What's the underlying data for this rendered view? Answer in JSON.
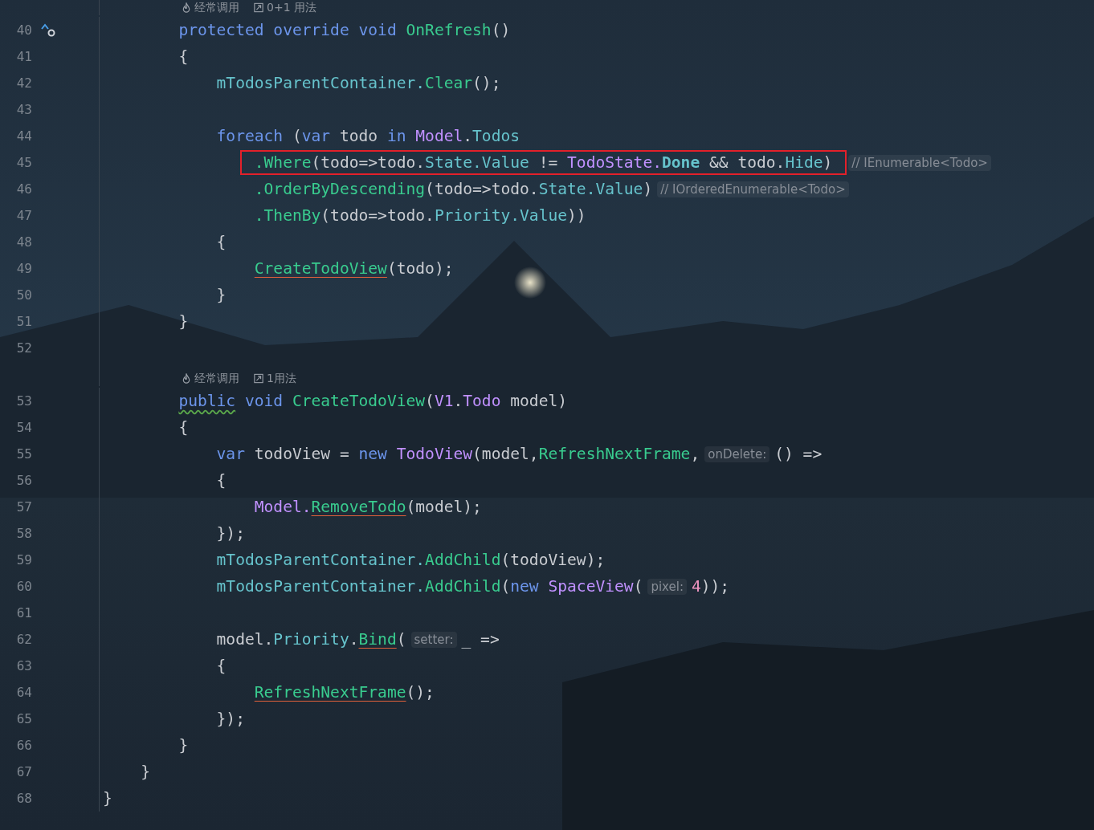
{
  "editor": {
    "lines": [
      {
        "kind": "lens",
        "items": [
          {
            "text": "经常调用"
          },
          {
            "text": "0+1 用法"
          }
        ]
      },
      {
        "kind": "code",
        "number": "40",
        "override_marker": true,
        "tokens": [
          {
            "kind": "kw",
            "text": "        protected override void "
          },
          {
            "kind": "fn",
            "text": "OnRefresh"
          },
          {
            "kind": "p",
            "text": "()"
          }
        ]
      },
      {
        "kind": "code",
        "number": "41",
        "tokens": [
          {
            "kind": "p",
            "text": "        {"
          }
        ]
      },
      {
        "kind": "code",
        "number": "42",
        "tokens": [
          {
            "kind": "m",
            "text": "            mTodosParentContainer."
          },
          {
            "kind": "fn",
            "text": "Clear"
          },
          {
            "kind": "p",
            "text": "();"
          }
        ]
      },
      {
        "kind": "code",
        "number": "43"
      },
      {
        "kind": "code",
        "number": "44",
        "tokens": [
          {
            "kind": "kw",
            "text": "            foreach"
          },
          {
            "kind": "p",
            "text": " ("
          },
          {
            "kind": "kw",
            "text": "var"
          },
          {
            "kind": "p",
            "text": " todo "
          },
          {
            "kind": "kw",
            "text": "in "
          },
          {
            "kind": "ty",
            "text": "Model"
          },
          {
            "kind": "p",
            "text": "."
          },
          {
            "kind": "m",
            "text": "Todos"
          }
        ]
      },
      {
        "kind": "code",
        "number": "45",
        "boxed": true,
        "tokens": [
          {
            "kind": "fn",
            "text": "                .Where"
          },
          {
            "kind": "p",
            "text": "(todo=>todo."
          },
          {
            "kind": "m",
            "text": "State.Value"
          },
          {
            "kind": "p",
            "text": " != "
          },
          {
            "kind": "ty",
            "text": "TodoState."
          },
          {
            "kind": "mb",
            "text": "Done"
          },
          {
            "kind": "p",
            "text": " && todo."
          },
          {
            "kind": "m",
            "text": "Hide"
          },
          {
            "kind": "p",
            "text": ")"
          },
          {
            "kind": "hint",
            "text": "// IEnumerable<Todo>"
          }
        ]
      },
      {
        "kind": "code",
        "number": "46",
        "tokens": [
          {
            "kind": "fn",
            "text": "                .OrderByDescending"
          },
          {
            "kind": "p",
            "text": "(todo=>todo."
          },
          {
            "kind": "m",
            "text": "State.Value"
          },
          {
            "kind": "p",
            "text": ")"
          },
          {
            "kind": "hint",
            "text": "// IOrderedEnumerable<Todo>"
          }
        ]
      },
      {
        "kind": "code",
        "number": "47",
        "tokens": [
          {
            "kind": "fn",
            "text": "                .ThenBy"
          },
          {
            "kind": "p",
            "text": "(todo=>todo."
          },
          {
            "kind": "m",
            "text": "Priority.Value"
          },
          {
            "kind": "p",
            "text": "))"
          }
        ]
      },
      {
        "kind": "code",
        "number": "48",
        "tokens": [
          {
            "kind": "p",
            "text": "            {"
          }
        ]
      },
      {
        "kind": "code",
        "number": "49",
        "tokens": [
          {
            "kind": "fn",
            "text": "                CreateTodoView",
            "error": true
          },
          {
            "kind": "p",
            "text": "(todo);"
          }
        ]
      },
      {
        "kind": "code",
        "number": "50",
        "tokens": [
          {
            "kind": "p",
            "text": "            }"
          }
        ]
      },
      {
        "kind": "code",
        "number": "51",
        "tokens": [
          {
            "kind": "p",
            "text": "        }"
          }
        ]
      },
      {
        "kind": "code",
        "number": "52"
      },
      {
        "kind": "lens",
        "items": [
          {
            "text": "经常调用"
          },
          {
            "text": "1用法"
          }
        ]
      },
      {
        "kind": "code",
        "number": "53",
        "tokens": [
          {
            "kind": "kw",
            "text": "        public",
            "warning": true
          },
          {
            "kind": "kw",
            "text": " void "
          },
          {
            "kind": "fn",
            "text": "CreateTodoView"
          },
          {
            "kind": "p",
            "text": "("
          },
          {
            "kind": "ty",
            "text": "V1"
          },
          {
            "kind": "p",
            "text": "."
          },
          {
            "kind": "ty",
            "text": "Todo"
          },
          {
            "kind": "p",
            "text": " model)"
          }
        ]
      },
      {
        "kind": "code",
        "number": "54",
        "tokens": [
          {
            "kind": "p",
            "text": "        {"
          }
        ]
      },
      {
        "kind": "code",
        "number": "55",
        "tokens": [
          {
            "kind": "kw",
            "text": "            var"
          },
          {
            "kind": "p",
            "text": " todoView = "
          },
          {
            "kind": "kw",
            "text": "new "
          },
          {
            "kind": "ty",
            "text": "TodoView"
          },
          {
            "kind": "p",
            "text": "(model,"
          },
          {
            "kind": "fn",
            "text": "RefreshNextFrame"
          },
          {
            "kind": "p",
            "text": ","
          },
          {
            "kind": "hint",
            "text": "onDelete:"
          },
          {
            "kind": "p",
            "text": "() =>"
          }
        ]
      },
      {
        "kind": "code",
        "number": "56",
        "tokens": [
          {
            "kind": "p",
            "text": "            {"
          }
        ]
      },
      {
        "kind": "code",
        "number": "57",
        "tokens": [
          {
            "kind": "ty",
            "text": "                Model."
          },
          {
            "kind": "fn",
            "text": "RemoveTodo",
            "error": true
          },
          {
            "kind": "p",
            "text": "(model);"
          }
        ]
      },
      {
        "kind": "code",
        "number": "58",
        "tokens": [
          {
            "kind": "p",
            "text": "            });"
          }
        ]
      },
      {
        "kind": "code",
        "number": "59",
        "tokens": [
          {
            "kind": "m",
            "text": "            mTodosParentContainer."
          },
          {
            "kind": "fn",
            "text": "AddChild"
          },
          {
            "kind": "p",
            "text": "(todoView);"
          }
        ]
      },
      {
        "kind": "code",
        "number": "60",
        "tokens": [
          {
            "kind": "m",
            "text": "            mTodosParentContainer."
          },
          {
            "kind": "fn",
            "text": "AddChild"
          },
          {
            "kind": "p",
            "text": "("
          },
          {
            "kind": "kw",
            "text": "new "
          },
          {
            "kind": "ty",
            "text": "SpaceView"
          },
          {
            "kind": "p",
            "text": "("
          },
          {
            "kind": "hint",
            "text": "pixel:"
          },
          {
            "kind": "num",
            "text": "4"
          },
          {
            "kind": "p",
            "text": "));"
          }
        ]
      },
      {
        "kind": "code",
        "number": "61"
      },
      {
        "kind": "code",
        "number": "62",
        "tokens": [
          {
            "kind": "p",
            "text": "            model."
          },
          {
            "kind": "m",
            "text": "Priority"
          },
          {
            "kind": "p",
            "text": "."
          },
          {
            "kind": "fn",
            "text": "Bind",
            "error": true
          },
          {
            "kind": "p",
            "text": "("
          },
          {
            "kind": "hint",
            "text": "setter:"
          },
          {
            "kind": "p",
            "text": "_ =>"
          }
        ]
      },
      {
        "kind": "code",
        "number": "63",
        "tokens": [
          {
            "kind": "p",
            "text": "            {"
          }
        ]
      },
      {
        "kind": "code",
        "number": "64",
        "tokens": [
          {
            "kind": "fn",
            "text": "                RefreshNextFrame",
            "error": true
          },
          {
            "kind": "p",
            "text": "();"
          }
        ]
      },
      {
        "kind": "code",
        "number": "65",
        "tokens": [
          {
            "kind": "p",
            "text": "            });"
          }
        ]
      },
      {
        "kind": "code",
        "number": "66",
        "tokens": [
          {
            "kind": "p",
            "text": "        }"
          }
        ]
      },
      {
        "kind": "code",
        "number": "67",
        "tokens": [
          {
            "kind": "p",
            "text": "    }"
          }
        ]
      },
      {
        "kind": "code",
        "number": "68",
        "tokens": [
          {
            "kind": "p",
            "text": "}"
          }
        ]
      }
    ]
  }
}
